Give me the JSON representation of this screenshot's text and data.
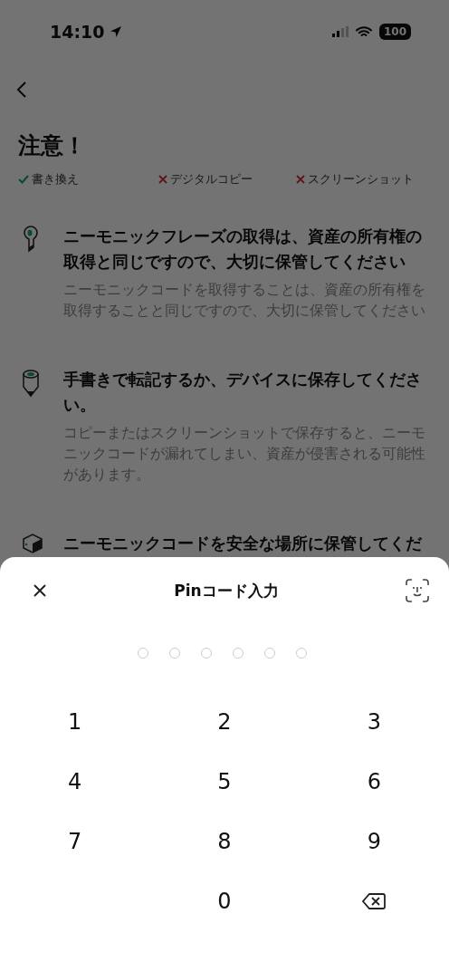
{
  "status_bar": {
    "time": "14:10",
    "battery": "100"
  },
  "page": {
    "title": "注意！",
    "rules": [
      {
        "kind": "allowed",
        "label": "書き換え"
      },
      {
        "kind": "denied",
        "label": "デジタルコピー"
      },
      {
        "kind": "denied",
        "label": "スクリーンショット"
      }
    ],
    "items": [
      {
        "kind": "key",
        "title": "ニーモニックフレーズの取得は、資産の所有権の取得と同じですので、大切に保管してください",
        "description": "ニーモニックコードを取得することは、資産の所有権を取得することと同じですので、大切に保管してください"
      },
      {
        "kind": "pencil",
        "title": "手書きで転記するか、デバイスに保存してください。",
        "description": "コピーまたはスクリーンショットで保存すると、ニーモニックコードが漏れてしまい、資産が侵害される可能性があります。"
      },
      {
        "kind": "box",
        "title": "ニーモニックコードを安全な場所に保管してくだ"
      }
    ]
  },
  "pin_sheet": {
    "title": "Pinコード入力",
    "dots": [
      {
        "filled": false
      },
      {
        "filled": false
      },
      {
        "filled": false
      },
      {
        "filled": false
      },
      {
        "filled": false
      },
      {
        "filled": false
      }
    ],
    "keys": [
      {
        "kind": "digit",
        "label": "1"
      },
      {
        "kind": "digit",
        "label": "2"
      },
      {
        "kind": "digit",
        "label": "3"
      },
      {
        "kind": "digit",
        "label": "4"
      },
      {
        "kind": "digit",
        "label": "5"
      },
      {
        "kind": "digit",
        "label": "6"
      },
      {
        "kind": "digit",
        "label": "7"
      },
      {
        "kind": "digit",
        "label": "8"
      },
      {
        "kind": "digit",
        "label": "9"
      },
      {
        "kind": "blank"
      },
      {
        "kind": "digit",
        "label": "0"
      },
      {
        "kind": "backspace"
      }
    ]
  }
}
